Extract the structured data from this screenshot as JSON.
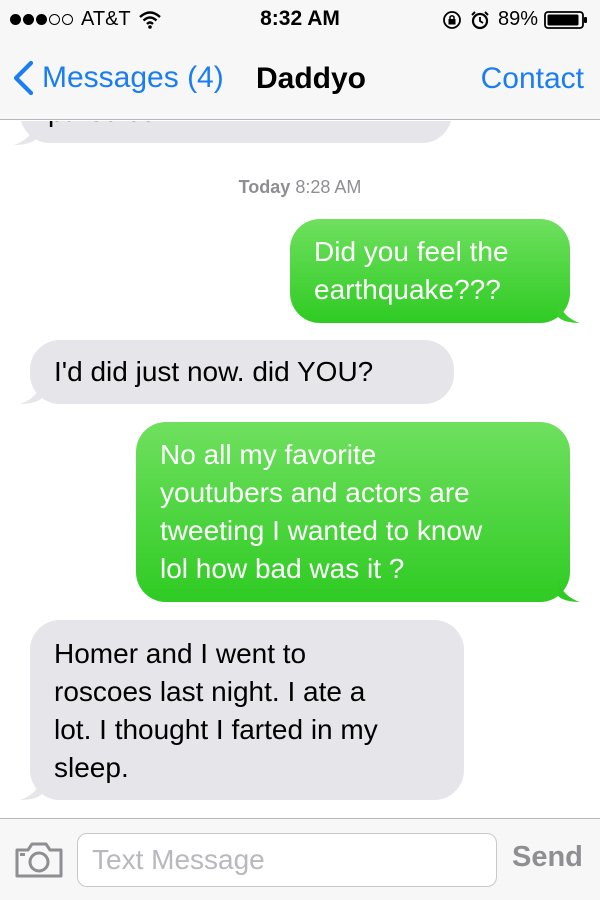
{
  "status_bar": {
    "carrier": "AT&T",
    "time": "8:32 AM",
    "battery": "89%",
    "signal_bars_filled": 3,
    "signal_bars_total": 5
  },
  "nav": {
    "back_label": "Messages (4)",
    "title": "Daddyo",
    "contact_label": "Contact"
  },
  "timestamp": {
    "day": "Today",
    "time": "8:28 AM"
  },
  "messages": [
    {
      "direction": "incoming",
      "lines": [
        "parodies."
      ]
    },
    {
      "direction": "outgoing",
      "lines": [
        "Did you feel the",
        "earthquake???"
      ]
    },
    {
      "direction": "incoming",
      "lines": [
        "I'd did just now. did YOU?"
      ]
    },
    {
      "direction": "outgoing",
      "lines": [
        "No all my favorite",
        "youtubers and actors are",
        "tweeting I wanted to know",
        "lol how bad was it ?"
      ]
    },
    {
      "direction": "incoming",
      "lines": [
        "Homer and I went to",
        "roscoes last night. I ate a",
        "lot. I thought I farted in my",
        "sleep."
      ]
    }
  ],
  "composer": {
    "placeholder": "Text Message",
    "send_label": "Send"
  },
  "colors": {
    "ios_blue": "#1a7ef2",
    "incoming_bubble": "#e5e5ea",
    "outgoing_bubble": "#4cd43f"
  }
}
